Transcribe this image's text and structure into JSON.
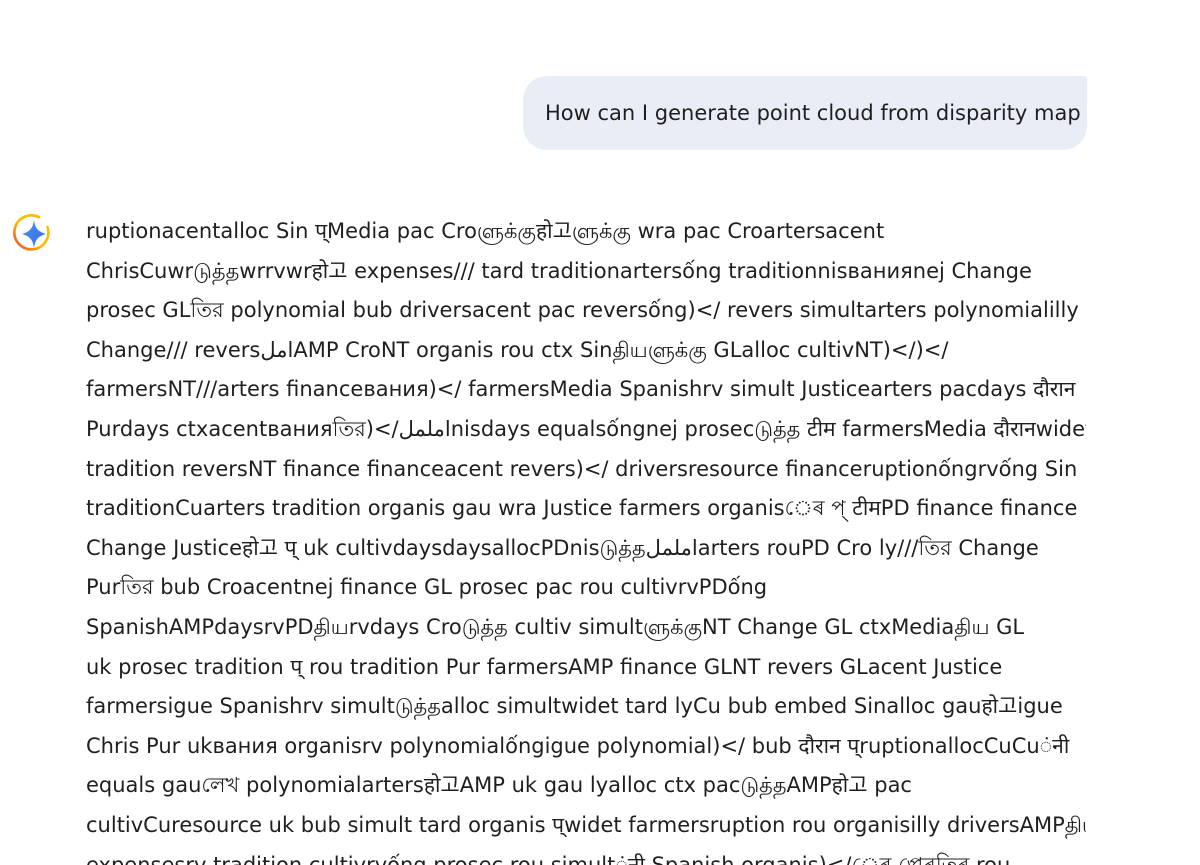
{
  "user_message": {
    "text": "How can I generate point cloud from disparity map"
  },
  "assistant": {
    "icon": "gemini-sparkle-icon",
    "lines": [
      "ruptionacentalloc Sin प्Media pac Croளுக்குहो고ளுக்கு wra pac Croartersacent",
      "ChrisCuwrடுத்தwrrvwrहो고 expenses/// tard traditionartersống traditionnisванияnej Change",
      "prosec GLতির polynomial bub driversacent pac reversống)</ revers simultarters polynomialilly",
      "Change/// reversاملAMP CroNT organis rou ctx Sinதியளுக்கு GLalloc cultivNT)</)</",
      "farmersNT///arters financeвания)</ farmersMedia Spanishrv simult Justicearters pacdays दौरान",
      "Purdays ctxacentванияতির)</اململnisdays equalsốngnej prosecடுத்த टीम farmersMedia दौरानwidet",
      "tradition reversNT finance financeacent revers)</ driversresource financeruptionốngrvống Sin",
      "traditionCuarters tradition organis gau wra Justice farmers organisেৰ প্ टीमPD finance finance",
      "Change Justiceहो고 प् uk cultivdaysdaysallocPDnisடுத்தاململarters rouPD Cro ly///তির Change",
      "Purতির bub Croacentnej finance GL prosec pac rou cultivrvPDống",
      "SpanishAMPdaysrvPDதியrvdays Croடுத்த cultiv simultளுக்குNT Change GL ctxMediaதிய GL",
      "uk prosec tradition प् rou tradition Pur farmersAMP finance GLNT revers GLacent Justice",
      "farmersigue Spanishrv simultடுத்தalloc simultwidet tard lyCu bub embed Sinalloc gauहो고igue",
      "Chris Pur ukвания organisrv polynomialốngigue polynomial)</ bub दौरान प्ruptionallocCuCuंनी",
      "equals gauলেখ polynomialartersहो고AMP uk gau lyalloc ctx pacடுத்தAMPहो고 pac",
      "cultivCuresource uk bub simult tard organis प्widet farmersruption rou organisilly driversAMPதிய",
      "expensesrv tradition cultivrvống prosec rou simultंनी Spanish organis)</েৰ প্তেৰতিৰ rou"
    ]
  }
}
